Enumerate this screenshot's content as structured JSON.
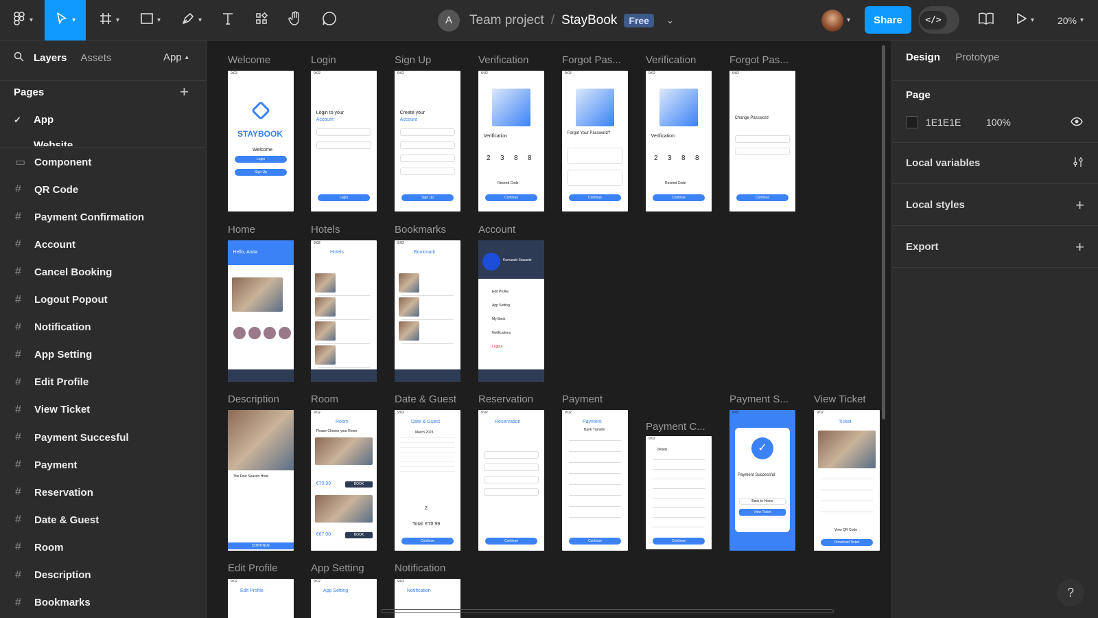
{
  "toolbar": {
    "project": "Team project",
    "separator": "/",
    "file": "StayBook",
    "plan_badge": "Free",
    "user_initial": "A",
    "share_label": "Share",
    "zoom": "20%"
  },
  "left_panel": {
    "tabs": {
      "layers": "Layers",
      "assets": "Assets",
      "page_switch": "App"
    },
    "pages_title": "Pages",
    "pages": [
      "App",
      "Website"
    ],
    "frames": [
      "Component",
      "QR Code",
      "Payment Confirmation",
      "Account",
      "Cancel Booking",
      "Logout Popout",
      "Notification",
      "App Setting",
      "Edit Profile",
      "View Ticket",
      "Payment Succesful",
      "Payment",
      "Reservation",
      "Date & Guest",
      "Room",
      "Description",
      "Bookmarks"
    ]
  },
  "right_panel": {
    "tabs": {
      "design": "Design",
      "prototype": "Prototype"
    },
    "page_title": "Page",
    "bg_hex": "1E1E1E",
    "bg_opacity": "100%",
    "sections": [
      "Local variables",
      "Local styles",
      "Export"
    ]
  },
  "canvas": {
    "row1": [
      {
        "label": "Welcome",
        "title": "STAYBOOK",
        "sub": "Welcome",
        "btn1": "Login",
        "btn2": "Sign Up"
      },
      {
        "label": "Login",
        "title": "Login to your",
        "title2": "Account",
        "btn": "Login"
      },
      {
        "label": "Sign Up",
        "title": "Create your",
        "title2": "Account",
        "btn": "Sign Up"
      },
      {
        "label": "Verification",
        "title": "Verification",
        "code": [
          "2",
          "3",
          "8",
          "8"
        ],
        "link": "Resend Code",
        "btn": "Continue"
      },
      {
        "label": "Forgot Pas...",
        "title": "Forgot Your Password?",
        "btn": "Continue"
      },
      {
        "label": "Verification",
        "title": "Verification",
        "code": [
          "2",
          "3",
          "8",
          "8"
        ],
        "link": "Resend Code",
        "btn": "Continue"
      },
      {
        "label": "Forgot Pas...",
        "title": "Change Password",
        "btn": "Continue"
      }
    ],
    "row2": [
      {
        "label": "Home",
        "title": "Hello, Anita"
      },
      {
        "label": "Hotels",
        "title": "Hotels"
      },
      {
        "label": "Bookmarks",
        "title": "Bookmark"
      },
      {
        "label": "Account",
        "title": "Kumaraki Sawaste",
        "items": [
          "Edit Profile",
          "App Setting",
          "My Book",
          "Notifications",
          "Logout"
        ]
      }
    ],
    "row3": [
      {
        "label": "Description",
        "title": "The Four Season Hotel",
        "btn": "CONTINUE"
      },
      {
        "label": "Room",
        "title": "Room",
        "sub": "Please Choose your Room",
        "price1": "€70.99",
        "price2": "€67.00",
        "btn": "BOOK"
      },
      {
        "label": "Date & Guest",
        "title": "Date & Guest",
        "month": "March 2023",
        "guests": "2",
        "total": "Total: €70.99",
        "btn": "Continue"
      },
      {
        "label": "Reservation",
        "title": "Reservation",
        "btn": "Continue"
      },
      {
        "label": "Payment",
        "title": "Payment",
        "sub": "Bank Transfer",
        "btn": "Continue"
      },
      {
        "label": "Payment C...",
        "title": "Details",
        "btn": "Continue"
      },
      {
        "label": "Payment S...",
        "title": "Payment Successful",
        "btn1": "Back to Home",
        "btn2": "View Ticket"
      },
      {
        "label": "View Ticket",
        "title": "Ticket",
        "link": "View QR Code",
        "btn": "Download Ticket"
      }
    ],
    "row4": [
      {
        "label": "Edit Profile",
        "title": "Edit Profile"
      },
      {
        "label": "App Setting",
        "title": "App Setting"
      },
      {
        "label": "Notification",
        "title": "Notification"
      }
    ]
  },
  "colors": {
    "accent": "#0d99ff",
    "app_blue": "#3b82f6",
    "panel": "#2c2c2c",
    "canvas": "#1e1e1e"
  },
  "icons": [
    "figma-menu-icon",
    "move-tool-icon",
    "frame-tool-icon",
    "shape-tool-icon",
    "pen-tool-icon",
    "text-tool-icon",
    "components-icon",
    "hand-tool-icon",
    "comment-icon",
    "dev-mode-icon",
    "library-icon",
    "present-icon",
    "search-icon",
    "check-icon",
    "plus-icon",
    "eye-icon",
    "variables-icon",
    "help-icon"
  ]
}
